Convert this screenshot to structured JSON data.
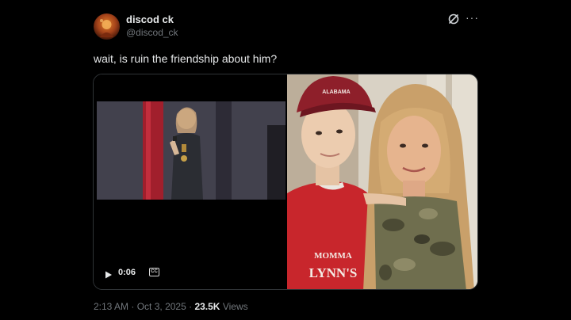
{
  "author": {
    "display_name": "discod ck",
    "handle": "@discod_ck",
    "avatar_icon": "avatar-image"
  },
  "header_icons": {
    "grok": "grok-icon",
    "more": "more-icon",
    "more_glyph": "···"
  },
  "post": {
    "text": "wait, is ruin the friendship about him?"
  },
  "video": {
    "time": "0:06",
    "play_icon": "play-icon",
    "captions_icon": "cc-icon"
  },
  "photo": {
    "cap_text": "ALABAMA",
    "shirt_text_1": "MOMMA",
    "shirt_text_2": "LYNN'S"
  },
  "meta": {
    "time": "2:13 AM",
    "separator": "·",
    "date": "Oct 3, 2025",
    "views_count": "23.5K",
    "views_label": "Views"
  },
  "colors": {
    "background": "#000000",
    "text": "#e7e9ea",
    "secondary": "#71767b",
    "border": "#2f3336"
  }
}
